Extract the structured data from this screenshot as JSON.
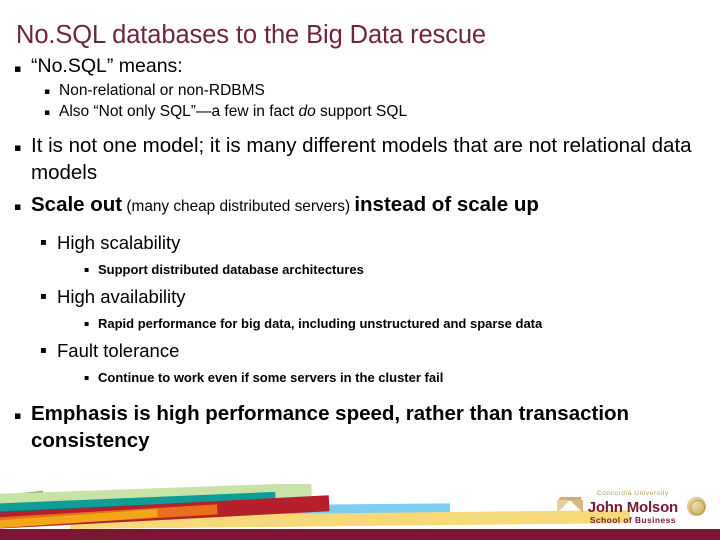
{
  "slide": {
    "title": "No.SQL databases to the Big Data rescue",
    "bullet_glyph": "▪",
    "title_color": "#6e2639",
    "accent_color": "#7a1733",
    "content": [
      {
        "level": 1,
        "text": "“No.SQL” means:"
      },
      {
        "level": 2,
        "text": "Non-relational or non-RDBMS"
      },
      {
        "level": 2,
        "text_pre": "Also “Not only SQL”—a few in fact ",
        "text_italic": "do",
        "text_post": " support SQL"
      },
      {
        "level": 1,
        "text": "It is not one model; it is many different models that are not relational data models"
      },
      {
        "level": 1,
        "text_bold_a": "Scale out",
        "text_small": " (many cheap distributed servers) ",
        "text_bold_b": "instead of scale up"
      },
      {
        "level": 2,
        "text": "High scalability"
      },
      {
        "level": 3,
        "text": "Support distributed database architectures"
      },
      {
        "level": 2,
        "text": "High availability"
      },
      {
        "level": 3,
        "text": "Rapid performance for big data, including unstructured and sparse data"
      },
      {
        "level": 2,
        "text": "Fault tolerance"
      },
      {
        "level": 3,
        "text": "Continue to work even if some servers in the cluster fail"
      },
      {
        "level": 1,
        "text": "Emphasis is high performance speed, rather than transaction consistency"
      }
    ]
  },
  "logo": {
    "university": "Concordia University",
    "name": "John Molson",
    "school": "School of Business"
  }
}
